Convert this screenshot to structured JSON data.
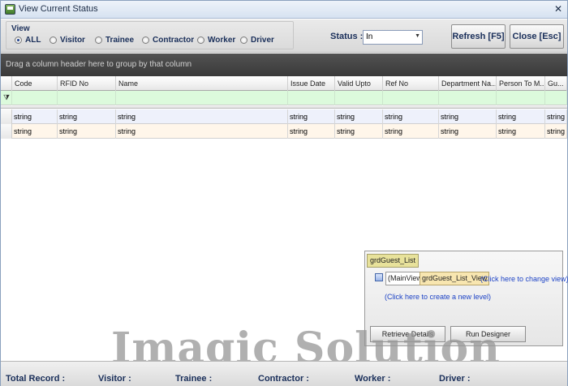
{
  "window": {
    "title": "View Current Status",
    "close_glyph": "✕"
  },
  "view": {
    "legend": "View",
    "options": [
      {
        "label": "ALL",
        "checked": true
      },
      {
        "label": "Visitor",
        "checked": false
      },
      {
        "label": "Trainee",
        "checked": false
      },
      {
        "label": "Contractor",
        "checked": false
      },
      {
        "label": "Worker",
        "checked": false
      },
      {
        "label": "Driver",
        "checked": false
      }
    ]
  },
  "status": {
    "label": "Status :",
    "value": "In"
  },
  "buttons": {
    "refresh": "Refresh [F5]",
    "close": "Close [Esc]"
  },
  "grid": {
    "group_hint": "Drag a column header here to group by that column",
    "columns": [
      "Code",
      "RFID No",
      "Name",
      "Issue Date",
      "Valid Upto",
      "Ref No",
      "Department Na...",
      "Person To M...",
      "Gu..."
    ],
    "rows": [
      [
        "string",
        "string",
        "string",
        "string",
        "string",
        "string",
        "string",
        "string",
        "string"
      ],
      [
        "string",
        "string",
        "string",
        "string",
        "string",
        "string",
        "string",
        "string",
        "string"
      ]
    ]
  },
  "designer": {
    "grid_name": "grdGuest_List",
    "main_view": "(MainView)",
    "view_name": "grdGuest_List_View",
    "change_view_link": "(Click here to change view)",
    "new_level_link": "(Click here to create a new level)",
    "retrieve_button": "Retrieve Details",
    "run_button": "Run Designer"
  },
  "watermark": "Imagic Solution",
  "footer": {
    "total_record": "Total Record :",
    "visitor": "Visitor :",
    "trainee": "Trainee :",
    "contractor": "Contractor :",
    "worker": "Worker :",
    "driver": "Driver :"
  },
  "colors": {
    "filter_row": "#dcfadc",
    "row_even": "#eef1fb",
    "row_odd": "#fff6ea",
    "group_panel": "#3a3a3a",
    "link": "#1d43c6"
  }
}
